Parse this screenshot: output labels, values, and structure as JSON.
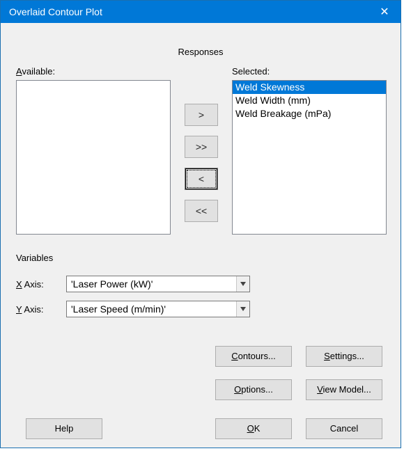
{
  "window": {
    "title": "Overlaid Contour Plot",
    "close_glyph": "✕"
  },
  "responses": {
    "heading": "Responses",
    "available_label_pre": "A",
    "available_label_post": "vailable:",
    "selected_label": "Selected:",
    "available_items": [],
    "selected_items": [
      {
        "text": "Weld Skewness",
        "selected": true
      },
      {
        "text": "Weld Width (mm)",
        "selected": false
      },
      {
        "text": "Weld Breakage (mPa)",
        "selected": false
      }
    ],
    "btn_right": ">",
    "btn_allright": ">>",
    "btn_left": "<",
    "btn_allleft": "<<"
  },
  "variables": {
    "heading": "Variables",
    "x_label_pre": "X",
    "x_label_post": " Axis:",
    "y_label_pre": "Y",
    "y_label_post": " Axis:",
    "x_value": "'Laser Power (kW)'",
    "y_value": "'Laser Speed (m/min)'"
  },
  "buttons": {
    "contours_pre": "C",
    "contours_post": "ontours...",
    "settings_pre": "S",
    "settings_post": "ettings...",
    "options_pre": "O",
    "options_post": "ptions...",
    "viewmodel_pre": "V",
    "viewmodel_post": "iew Model...",
    "help": "Help",
    "ok_pre": "O",
    "ok_post": "K",
    "cancel": "Cancel"
  }
}
